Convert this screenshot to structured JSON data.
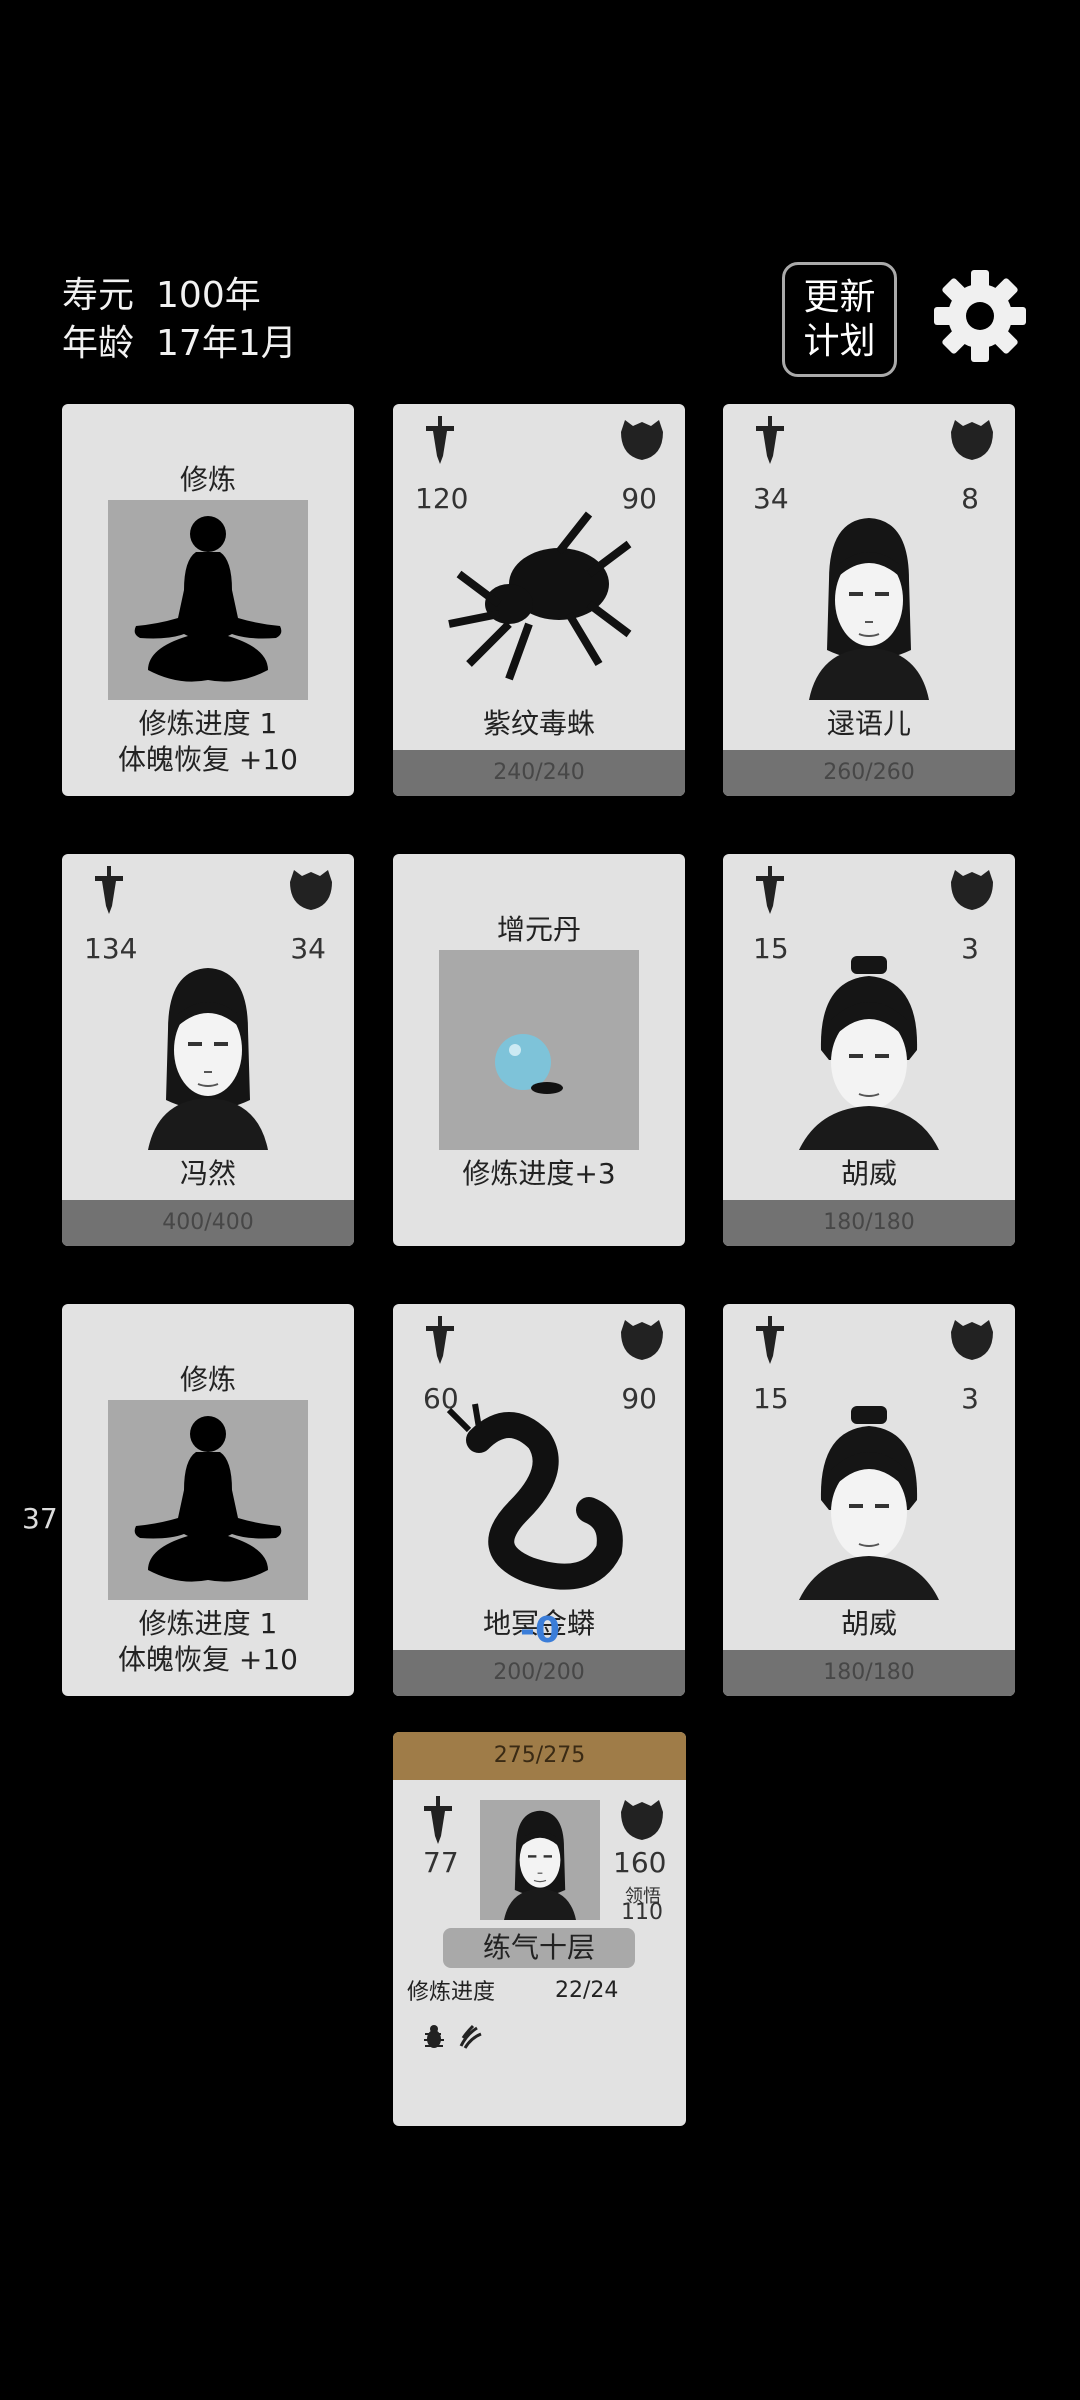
{
  "hud": {
    "lifespan_label": "寿元",
    "lifespan_value": "100年",
    "age_label": "年龄",
    "age_value": "17年1月",
    "update_button": "更新\n计划",
    "settings_icon": "gear-icon"
  },
  "side_counter": "37",
  "damage_popup": "-0",
  "cards": {
    "c1": {
      "title": "修炼",
      "line1": "修炼进度  1",
      "line2": "体魄恢复  +10"
    },
    "c2": {
      "attack": "120",
      "defense": "90",
      "name": "紫纹毒蛛",
      "hp": "240/240"
    },
    "c3": {
      "attack": "34",
      "defense": "8",
      "name": "逯语儿",
      "hp": "260/260"
    },
    "c4": {
      "attack": "134",
      "defense": "34",
      "name": "冯然",
      "hp": "400/400"
    },
    "c5": {
      "title": "增元丹",
      "line1": "修炼进度+3"
    },
    "c6": {
      "attack": "15",
      "defense": "3",
      "name": "胡威",
      "hp": "180/180"
    },
    "c7": {
      "title": "修炼",
      "line1": "修炼进度  1",
      "line2": "体魄恢复  +10"
    },
    "c8": {
      "attack": "60",
      "defense": "90",
      "name": "地冥金蟒",
      "hp": "200/200"
    },
    "c9": {
      "attack": "15",
      "defense": "3",
      "name": "胡威",
      "hp": "180/180"
    }
  },
  "player": {
    "hp": "275/275",
    "attack": "77",
    "defense": "160",
    "comprehension_label": "领悟",
    "comprehension_value": "110",
    "realm": "练气十层",
    "progress_label": "修炼进度",
    "progress_value": "22/24",
    "status_icons": [
      "bug-icon",
      "claw-icon"
    ]
  },
  "colors": {
    "background": "#000000",
    "card": "#e2e2e2",
    "hp_bar": "#727272",
    "player_hp_bar": "#9f7c48",
    "art_bg": "#a9a9a9"
  }
}
